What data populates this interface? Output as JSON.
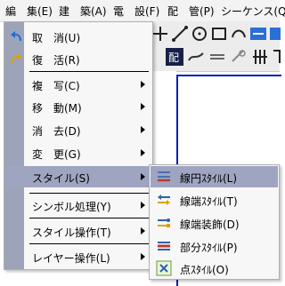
{
  "menubar": {
    "items": [
      {
        "label": "編　集(E)"
      },
      {
        "label": "建　築(A)"
      },
      {
        "label": "電　設(F)"
      },
      {
        "label": "配　管(P)"
      },
      {
        "label": "シーケンス(Q)"
      }
    ]
  },
  "edit_menu": {
    "items": [
      {
        "label": "取　消(U)",
        "icon": "undo-icon"
      },
      {
        "label": "復　活(R)",
        "icon": "redo-icon"
      },
      {
        "label": "複　写(C)"
      },
      {
        "label": "移　動(M)"
      },
      {
        "label": "消　去(D)"
      },
      {
        "label": "変　更(G)"
      },
      {
        "label": "スタイル(S)"
      },
      {
        "label": "シンボル処理(Y)"
      },
      {
        "label": "スタイル操作(T)"
      },
      {
        "label": "レイヤー操作(L)"
      }
    ]
  },
  "style_submenu": {
    "items": [
      {
        "label": "線円ｽﾀｲﾙ(L)",
        "icon": "line-circle-style-icon"
      },
      {
        "label": "線端ｽﾀｲﾙ(T)",
        "icon": "line-end-style-icon"
      },
      {
        "label": "線端装飾(D)",
        "icon": "line-end-decoration-icon"
      },
      {
        "label": "部分ｽﾀｲﾙ(P)",
        "icon": "partial-style-icon"
      },
      {
        "label": "点ｽﾀｲﾙ(O)",
        "icon": "point-style-icon"
      }
    ]
  },
  "colors": {
    "highlight": "#9fa4c0",
    "icon_strip": "#9da3b8",
    "canvas_border": "#0a1dbf"
  }
}
